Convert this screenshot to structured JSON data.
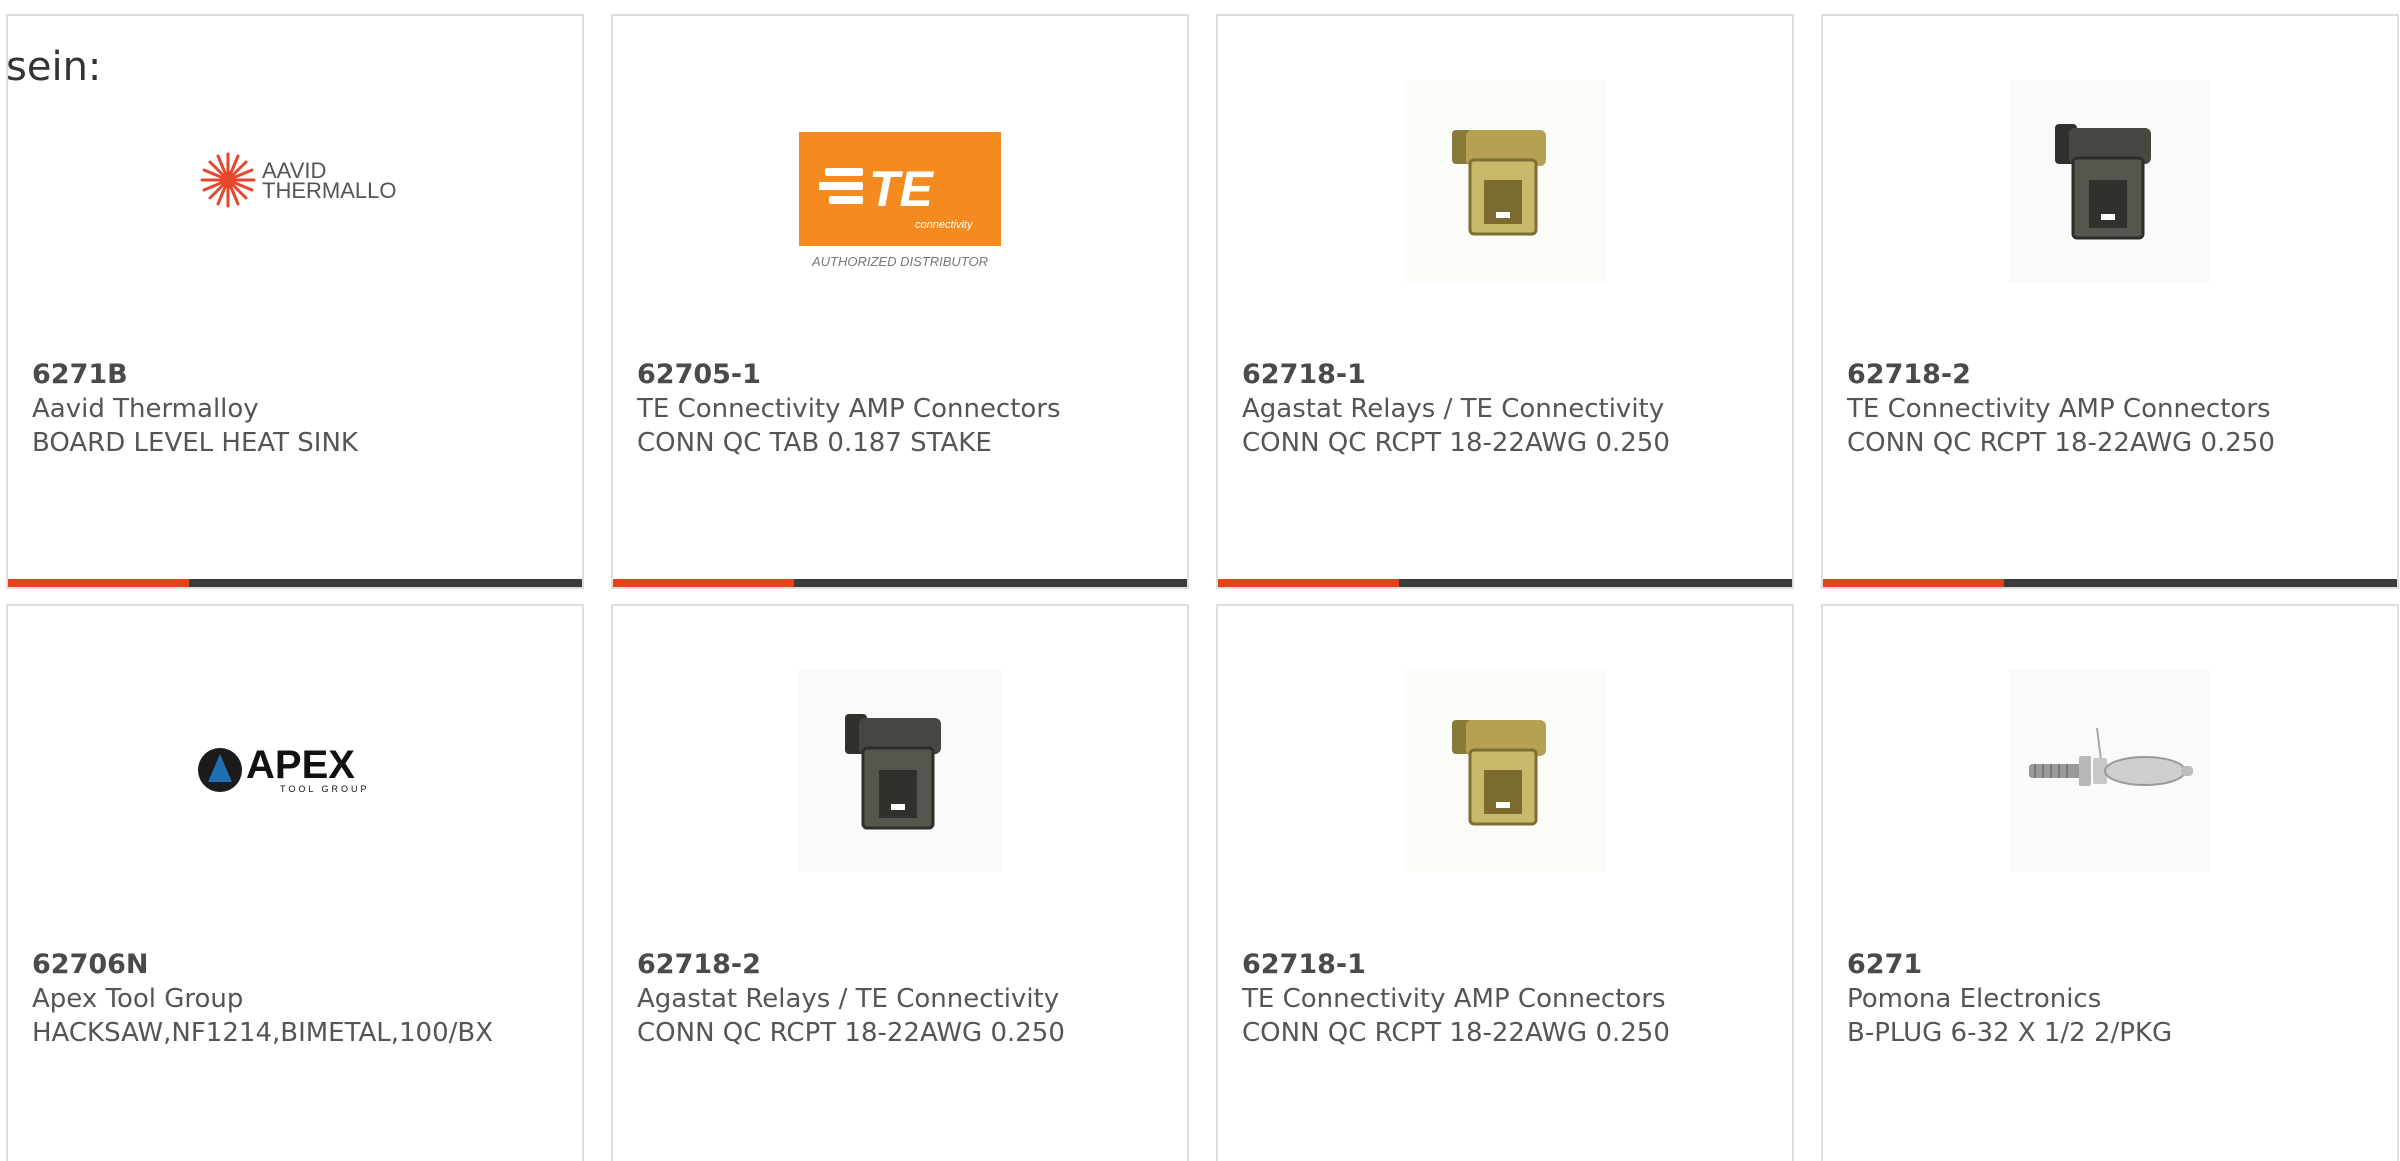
{
  "intro_text": "sein:",
  "colors": {
    "accent": "#e8401b",
    "bar": "#3b3b3b",
    "border": "#dedede",
    "text": "#555555"
  },
  "products": [
    {
      "part_number": "6271B",
      "manufacturer": "Aavid Thermalloy",
      "description": "BOARD LEVEL HEAT SINK",
      "image": "aavid-thermalloy-logo",
      "logo_text_1": "AAVID",
      "logo_text_2": "THERMALLOY"
    },
    {
      "part_number": "62705-1",
      "manufacturer": "TE Connectivity AMP Connectors",
      "description": "CONN QC TAB 0.187 STAKE",
      "image": "te-connectivity-logo",
      "logo_text_1": "TE",
      "logo_text_2": "connectivity",
      "logo_caption": "AUTHORIZED DISTRIBUTOR"
    },
    {
      "part_number": "62718-1",
      "manufacturer": "Agastat Relays / TE Connectivity",
      "description": "CONN QC RCPT 18-22AWG 0.250",
      "image": "brass-quick-connect"
    },
    {
      "part_number": "62718-2",
      "manufacturer": "TE Connectivity AMP Connectors",
      "description": "CONN QC RCPT 18-22AWG 0.250",
      "image": "dark-quick-connect"
    },
    {
      "part_number": "62706N",
      "manufacturer": "Apex Tool Group",
      "description": "HACKSAW,NF1214,BIMETAL,100/BX",
      "image": "apex-tool-group-logo",
      "logo_text_1": "APEX",
      "logo_text_2": "TOOL GROUP"
    },
    {
      "part_number": "62718-2",
      "manufacturer": "Agastat Relays / TE Connectivity",
      "description": "CONN QC RCPT 18-22AWG 0.250",
      "image": "dark-quick-connect"
    },
    {
      "part_number": "62718-1",
      "manufacturer": "TE Connectivity AMP Connectors",
      "description": "CONN QC RCPT 18-22AWG 0.250",
      "image": "brass-quick-connect"
    },
    {
      "part_number": "6271",
      "manufacturer": "Pomona Electronics",
      "description": "B-PLUG 6-32 X 1/2 2/PKG",
      "image": "banana-plug"
    }
  ]
}
